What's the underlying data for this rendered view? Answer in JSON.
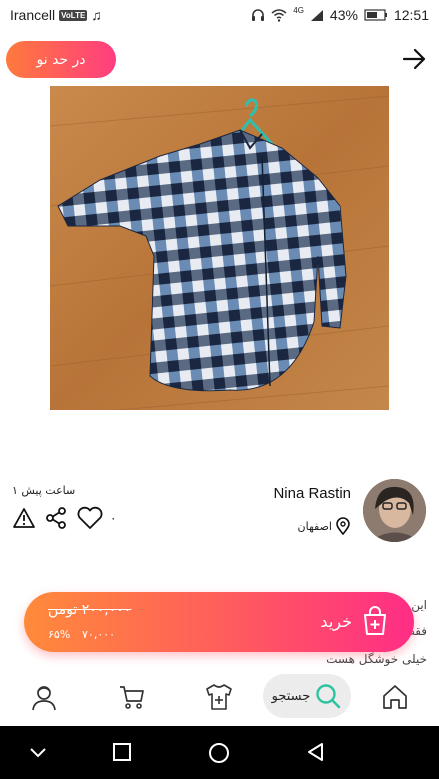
{
  "status": {
    "carrier": "Irancell",
    "volte": "VoLTE",
    "battery": "43%",
    "time": "12:51",
    "network": "4G"
  },
  "top": {
    "condition_badge": "در حد نو"
  },
  "listing": {
    "time_ago": "۱ ساعت پیش",
    "likes": "۰",
    "seller_name": "Nina Rastin",
    "location": "اصفهان",
    "description_lines": [
      "این",
      "فقط",
      "خیلی خوشگل هست"
    ]
  },
  "purchase": {
    "old_price": "۲۰۰,۰۰۰ تومن",
    "new_price": "۷۰,۰۰۰",
    "discount": "۶۵%",
    "buy_label": "خرید"
  },
  "nav": {
    "search_label": "جستجو",
    "items": [
      "profile",
      "cart",
      "add-item",
      "search",
      "home"
    ]
  },
  "colors": {
    "gradient_start": "#ff8a3a",
    "gradient_end": "#ff2d86",
    "search_accent": "#2ec4a0"
  }
}
